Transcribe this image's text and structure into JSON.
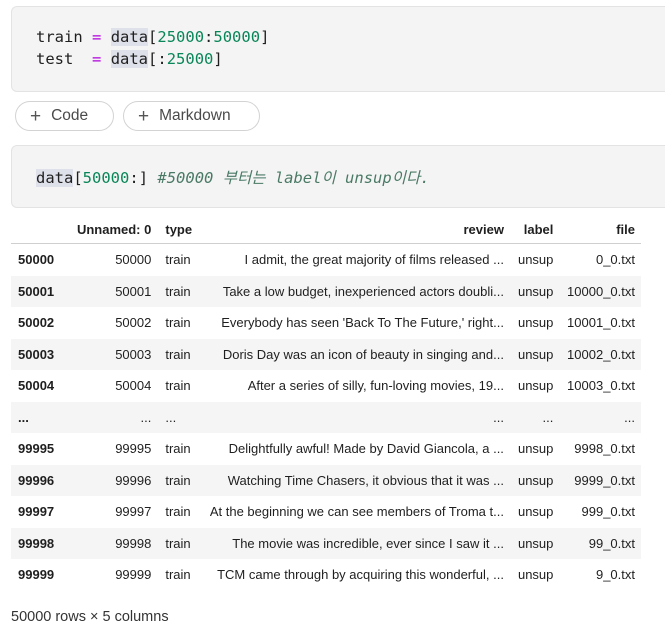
{
  "cell1": {
    "line1": {
      "var": "train",
      "op": "=",
      "obj": "data",
      "open": "[",
      "start": "25000",
      "colon": ":",
      "end": "50000",
      "close": "]"
    },
    "line2": {
      "var": "test",
      "op": "=",
      "obj": "data",
      "open": "[",
      "colon": ":",
      "end": "25000",
      "close": "]"
    }
  },
  "buttons": {
    "code_label": "Code",
    "markdown_label": "Markdown",
    "plus": "+"
  },
  "cell2": {
    "obj": "data",
    "open": "[",
    "start": "50000",
    "colon": ":",
    "close": "]",
    "comment": "#50000 부터는 label이 unsup이다."
  },
  "table": {
    "columns": [
      "",
      "Unnamed: 0",
      "type",
      "review",
      "label",
      "file"
    ],
    "rows": [
      [
        "50000",
        "50000",
        "train",
        "I admit, the great majority of films released ...",
        "unsup",
        "0_0.txt"
      ],
      [
        "50001",
        "50001",
        "train",
        "Take a low budget, inexperienced actors doubli...",
        "unsup",
        "10000_0.txt"
      ],
      [
        "50002",
        "50002",
        "train",
        "Everybody has seen 'Back To The Future,' right...",
        "unsup",
        "10001_0.txt"
      ],
      [
        "50003",
        "50003",
        "train",
        "Doris Day was an icon of beauty in singing and...",
        "unsup",
        "10002_0.txt"
      ],
      [
        "50004",
        "50004",
        "train",
        "After a series of silly, fun-loving movies, 19...",
        "unsup",
        "10003_0.txt"
      ],
      [
        "...",
        "...",
        "...",
        "...",
        "...",
        "..."
      ],
      [
        "99995",
        "99995",
        "train",
        "Delightfully awful! Made by David Giancola, a ...",
        "unsup",
        "9998_0.txt"
      ],
      [
        "99996",
        "99996",
        "train",
        "Watching Time Chasers, it obvious that it was ...",
        "unsup",
        "9999_0.txt"
      ],
      [
        "99997",
        "99997",
        "train",
        "At the beginning we can see members of Troma t...",
        "unsup",
        "999_0.txt"
      ],
      [
        "99998",
        "99998",
        "train",
        "The movie was incredible, ever since I saw it ...",
        "unsup",
        "99_0.txt"
      ],
      [
        "99999",
        "99999",
        "train",
        "TCM came through by acquiring this wonderful, ...",
        "unsup",
        "9_0.txt"
      ]
    ]
  },
  "footer": "50000 rows × 5 columns"
}
